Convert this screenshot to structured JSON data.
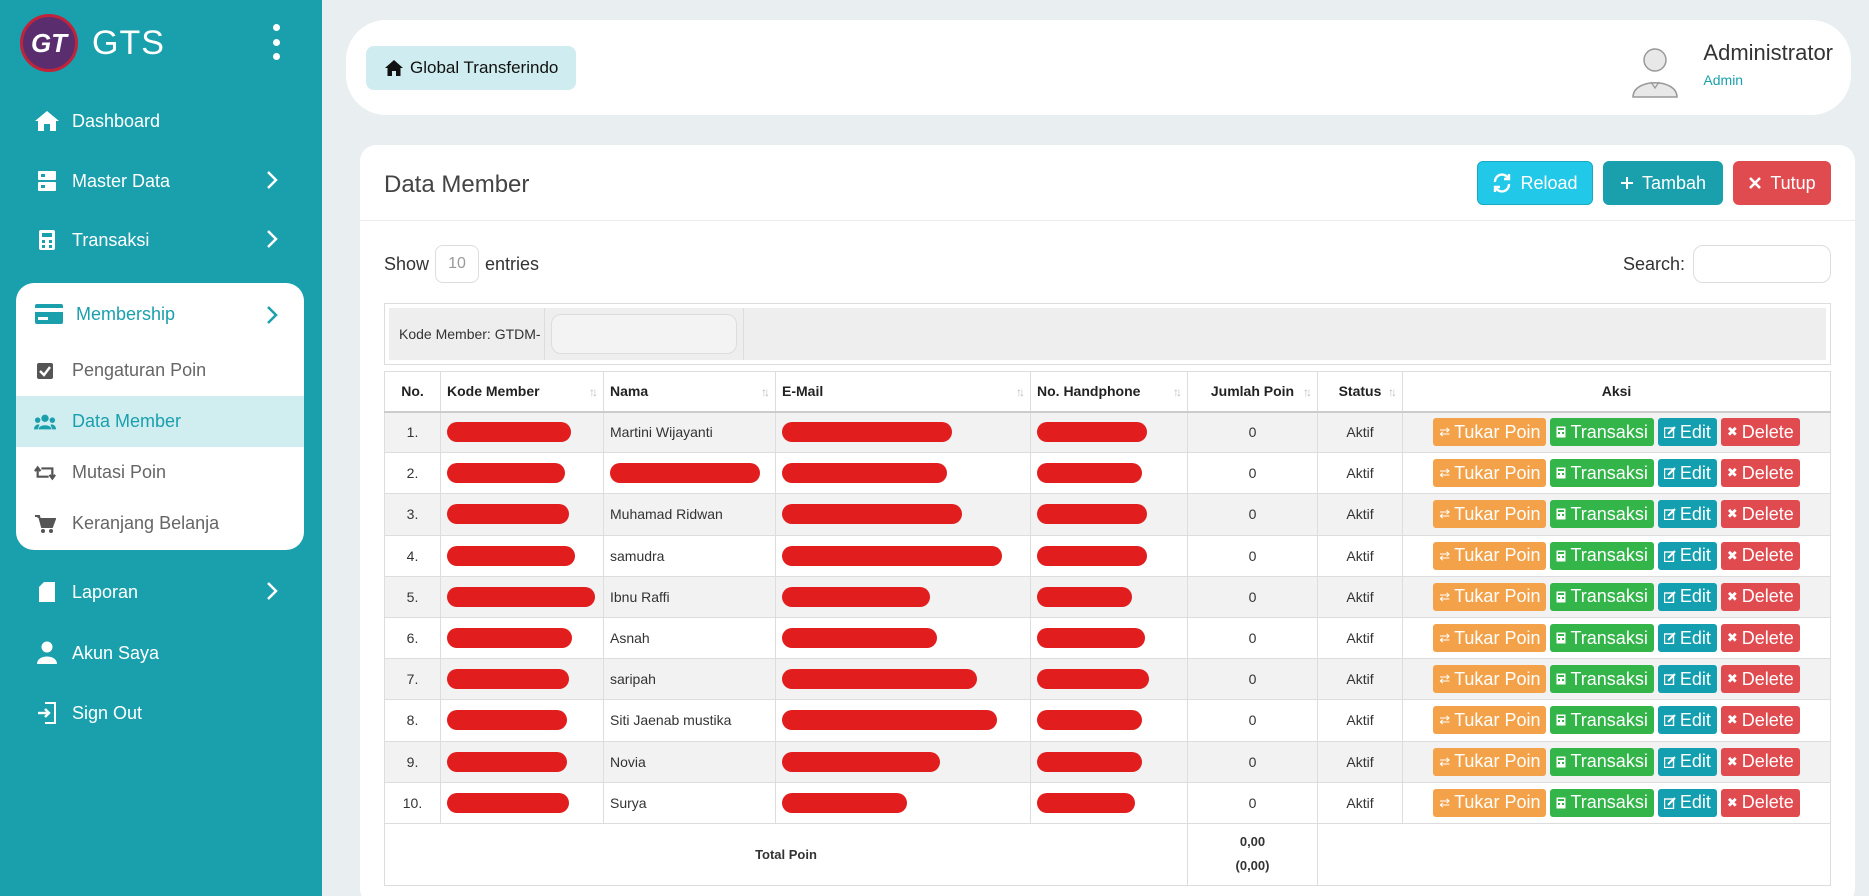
{
  "brand": {
    "logo_text": "GT",
    "name": "GTS"
  },
  "sidebar": {
    "items": [
      {
        "label": "Dashboard",
        "icon": "home-icon"
      },
      {
        "label": "Master Data",
        "icon": "server-icon"
      },
      {
        "label": "Transaksi",
        "icon": "calculator-icon"
      },
      {
        "label": "Laporan",
        "icon": "file-icon"
      },
      {
        "label": "Akun Saya",
        "icon": "user-icon"
      },
      {
        "label": "Sign Out",
        "icon": "sign-out-icon"
      }
    ],
    "membership": {
      "label": "Membership",
      "icon": "credit-card-icon",
      "items": [
        {
          "label": "Pengaturan Poin",
          "icon": "check-square-icon"
        },
        {
          "label": "Data Member",
          "icon": "users-icon",
          "active": true
        },
        {
          "label": "Mutasi Poin",
          "icon": "retweet-icon"
        },
        {
          "label": "Keranjang Belanja",
          "icon": "cart-icon"
        }
      ]
    }
  },
  "header": {
    "breadcrumb": "Global Transferindo",
    "user_name": "Administrator",
    "user_role": "Admin"
  },
  "card": {
    "title": "Data Member",
    "buttons": {
      "reload": "Reload",
      "tambah": "Tambah",
      "tutup": "Tutup"
    }
  },
  "table_controls": {
    "show_label": "Show",
    "show_value": "10",
    "entries_label": "entries",
    "search_label": "Search:"
  },
  "filter": {
    "label": "Kode Member: GTDM-"
  },
  "table": {
    "columns": [
      "No.",
      "Kode Member",
      "Nama",
      "E-Mail",
      "No. Handphone",
      "Jumlah Poin",
      "Status",
      "Aksi"
    ],
    "rows": [
      {
        "no": "1.",
        "nama": "Martini Wijayanti",
        "poin": "0",
        "status": "Aktif"
      },
      {
        "no": "2.",
        "nama": "",
        "poin": "0",
        "status": "Aktif"
      },
      {
        "no": "3.",
        "nama": "Muhamad Ridwan",
        "poin": "0",
        "status": "Aktif"
      },
      {
        "no": "4.",
        "nama": "samudra",
        "poin": "0",
        "status": "Aktif"
      },
      {
        "no": "5.",
        "nama": "Ibnu Raffi",
        "poin": "0",
        "status": "Aktif"
      },
      {
        "no": "6.",
        "nama": "Asnah",
        "poin": "0",
        "status": "Aktif"
      },
      {
        "no": "7.",
        "nama": "saripah",
        "poin": "0",
        "status": "Aktif"
      },
      {
        "no": "8.",
        "nama": "Siti Jaenab mustika",
        "poin": "0",
        "status": "Aktif"
      },
      {
        "no": "9.",
        "nama": "Novia",
        "poin": "0",
        "status": "Aktif"
      },
      {
        "no": "10.",
        "nama": "Surya",
        "poin": "0",
        "status": "Aktif"
      }
    ],
    "actions": {
      "tukar": "Tukar Poin",
      "transaksi": "Transaksi",
      "edit": "Edit",
      "delete": "Delete"
    },
    "footer": {
      "label": "Total Poin",
      "value": "0,00",
      "value2": "(0,00)"
    }
  },
  "colors": {
    "primary": "#1aa0ad",
    "reload": "#22c8e8",
    "danger": "#e04b50",
    "warning": "#f4a24a",
    "success": "#33b54a"
  }
}
